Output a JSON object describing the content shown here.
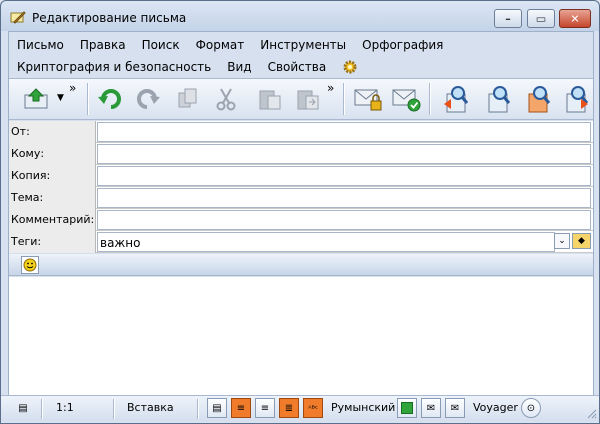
{
  "window": {
    "title": "Редактирование письма"
  },
  "menu": {
    "row1": [
      "Письмо",
      "Правка",
      "Поиск",
      "Формат",
      "Инструменты",
      "Орфография"
    ],
    "row2": [
      "Криптография и безопасность",
      "Вид",
      "Свойства"
    ]
  },
  "toolbar": {
    "icons": [
      "send-icon",
      "send-menu-arrow-icon",
      "undo-icon",
      "redo-icon",
      "copy-icon",
      "cut-icon",
      "paste-icon",
      "paste-special-icon",
      "encrypt-icon",
      "sign-icon",
      "find-prev-icon",
      "find-icon",
      "find-highlight-icon",
      "find-next-icon"
    ],
    "overflow": "»"
  },
  "headers": {
    "from": {
      "label": "От:",
      "value": ""
    },
    "to": {
      "label": "Кому:",
      "value": ""
    },
    "cc": {
      "label": "Копия:",
      "value": ""
    },
    "subject": {
      "label": "Тема:",
      "value": ""
    },
    "comment": {
      "label": "Комментарий:",
      "value": ""
    },
    "tags": {
      "label": "Теги:",
      "value": "важно"
    }
  },
  "status": {
    "position": "1:1",
    "mode": "Вставка",
    "language": "Румынский",
    "client": "Voyager"
  },
  "colors": {
    "accent": "#f07b2a",
    "frame": "#5b6f8c"
  }
}
